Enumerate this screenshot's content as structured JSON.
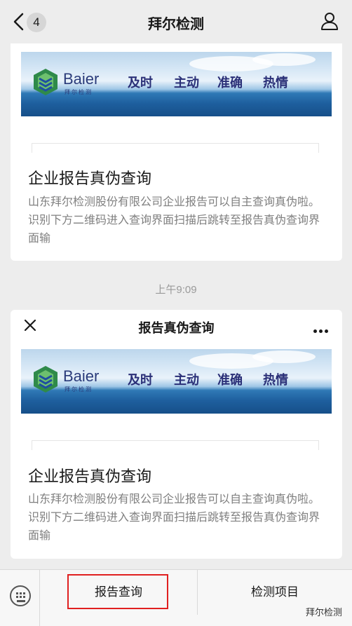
{
  "nav": {
    "title": "拜尔检测",
    "badge": "4"
  },
  "articles": [
    {
      "brand": "Baier",
      "brand_sub": "拜尔检测",
      "slogans": [
        "及时",
        "主动",
        "准确",
        "热情"
      ],
      "title": "企业报告真伪查询",
      "description": "山东拜尔检测股份有限公司企业报告可以自主查询真伪啦。识别下方二维码进入查询界面扫描后跳转至报告真伪查询界面输"
    },
    {
      "header": "报告真伪查询",
      "brand": "Baier",
      "brand_sub": "拜尔检测",
      "slogans": [
        "及时",
        "主动",
        "准确",
        "热情"
      ],
      "title": "企业报告真伪查询",
      "description": "山东拜尔检测股份有限公司企业报告可以自主查询真伪啦。识别下方二维码进入查询界面扫描后跳转至报告真伪查询界面输"
    }
  ],
  "timestamp": "上午9:09",
  "menu": {
    "items": [
      "报告查询",
      "检测项目"
    ]
  },
  "watermark": "拜尔检测",
  "colors": {
    "highlight": "#e02020",
    "brand_text": "#2a3b7a"
  }
}
